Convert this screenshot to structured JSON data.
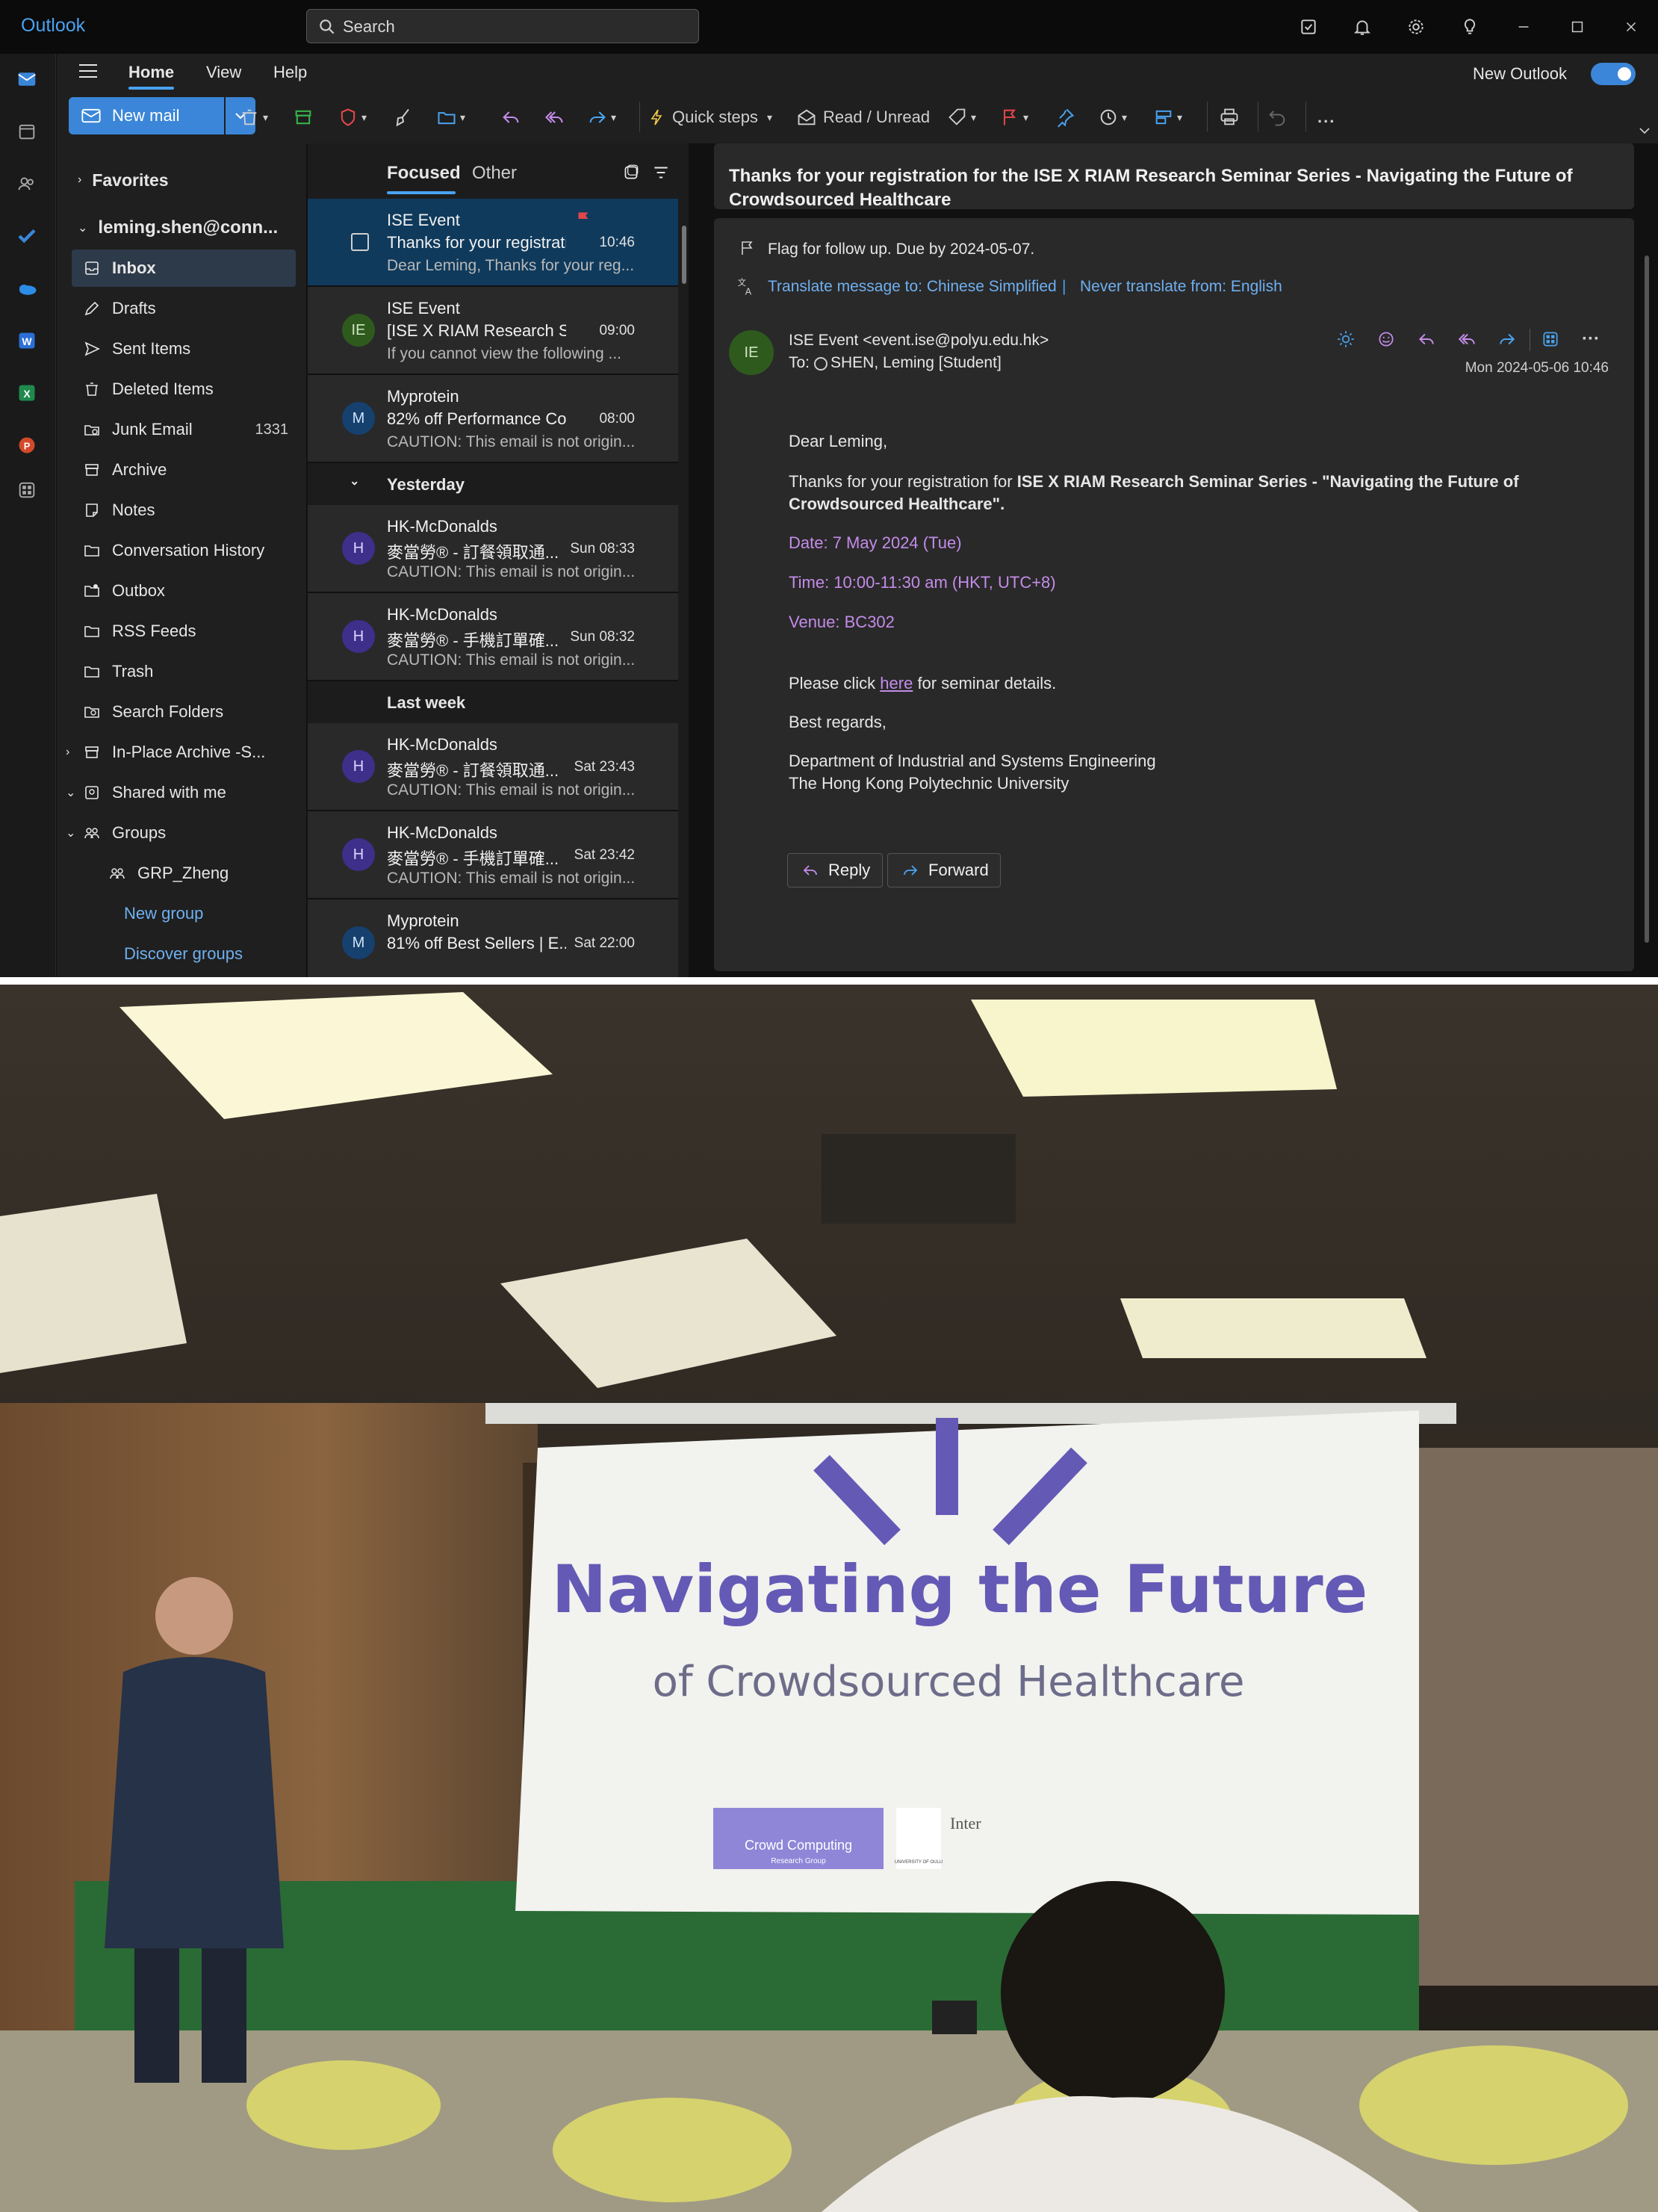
{
  "titlebar": {
    "app_name": "Outlook",
    "search_placeholder": "Search"
  },
  "ribbon": {
    "tabs": [
      "Home",
      "View",
      "Help"
    ],
    "new_outlook_label": "New Outlook",
    "new_mail_label": "New mail",
    "quick_steps_label": "Quick steps",
    "read_unread_label": "Read / Unread",
    "more_label": "..."
  },
  "folders": {
    "favorites_label": "Favorites",
    "account_label": "leming.shen@conn...",
    "items": [
      {
        "label": "Inbox",
        "count": ""
      },
      {
        "label": "Drafts",
        "count": ""
      },
      {
        "label": "Sent Items",
        "count": ""
      },
      {
        "label": "Deleted Items",
        "count": ""
      },
      {
        "label": "Junk Email",
        "count": "1331"
      },
      {
        "label": "Archive",
        "count": ""
      },
      {
        "label": "Notes",
        "count": ""
      },
      {
        "label": "Conversation History",
        "count": ""
      },
      {
        "label": "Outbox",
        "count": ""
      },
      {
        "label": "RSS Feeds",
        "count": ""
      },
      {
        "label": "Trash",
        "count": ""
      },
      {
        "label": "Search Folders",
        "count": ""
      },
      {
        "label": "In-Place Archive -S...",
        "count": ""
      },
      {
        "label": "Shared with me",
        "count": ""
      },
      {
        "label": "Groups",
        "count": ""
      },
      {
        "label": "GRP_Zheng",
        "count": ""
      }
    ],
    "new_group_label": "New group",
    "discover_groups_label": "Discover groups"
  },
  "maillist": {
    "tab_focused": "Focused",
    "tab_other": "Other",
    "group_yesterday": "Yesterday",
    "group_last_week": "Last week",
    "messages": [
      {
        "avatar": "",
        "from": "ISE Event",
        "subject": "Thanks for your registrati...",
        "time": "10:46",
        "preview": "Dear Leming, Thanks for your reg..."
      },
      {
        "avatar": "IE",
        "from": "ISE Event",
        "subject": "[ISE X RIAM Research Se...",
        "time": "09:00",
        "preview": "If you cannot view the following ..."
      },
      {
        "avatar": "M",
        "from": "Myprotein",
        "subject": "82% off Performance Coo...",
        "time": "08:00",
        "preview": "CAUTION: This email is not origin..."
      },
      {
        "avatar": "H",
        "from": "HK-McDonalds",
        "subject": "麥當勞® - 訂餐領取通...",
        "time": "Sun 08:33",
        "preview": "CAUTION: This email is not origin..."
      },
      {
        "avatar": "H",
        "from": "HK-McDonalds",
        "subject": "麥當勞® - 手機訂單確...",
        "time": "Sun 08:32",
        "preview": "CAUTION: This email is not origin..."
      },
      {
        "avatar": "H",
        "from": "HK-McDonalds",
        "subject": "麥當勞® - 訂餐領取通...",
        "time": "Sat 23:43",
        "preview": "CAUTION: This email is not origin..."
      },
      {
        "avatar": "H",
        "from": "HK-McDonalds",
        "subject": "麥當勞® - 手機訂單確...",
        "time": "Sat 23:42",
        "preview": "CAUTION: This email is not origin..."
      },
      {
        "avatar": "M",
        "from": "Myprotein",
        "subject": "81% off Best Sellers | E...",
        "time": "Sat 22:00",
        "preview": ""
      }
    ]
  },
  "reading": {
    "subject": "Thanks for your registration for the ISE X RIAM Research Seminar Series - Navigating the Future of Crowdsourced Healthcare",
    "flag_text": "Flag for follow up. Due by 2024-05-07.",
    "translate_text": "Translate message to: Chinese Simplified",
    "translate_sep": "|",
    "never_translate_text": "Never translate from: English",
    "sender_avatar": "IE",
    "sender": "ISE Event <event.ise@polyu.edu.hk>",
    "to_label": "To:",
    "to_value": "SHEN, Leming [Student]",
    "date": "Mon 2024-05-06 10:46",
    "greeting": "Dear Leming,",
    "thanks_prefix": "Thanks for your registration for ",
    "thanks_bold_1": "ISE X RIAM Research Seminar Series - \"Navigating the Future of",
    "thanks_bold_2": "Crowdsourced Healthcare\".",
    "date_line": "Date: 7 May 2024 (Tue)",
    "time_line": "Time: 10:00-11:30 am (HKT, UTC+8)",
    "venue_line": "Venue: BC302",
    "click_prefix": "Please click ",
    "click_link": "here",
    "click_suffix": " for seminar details.",
    "regards": "Best regards,",
    "dept": "Department of Industrial and Systems Engineering",
    "univ": "The Hong Kong Polytechnic University",
    "reply_label": "Reply",
    "forward_label": "Forward"
  },
  "photo": {
    "slide_title": "Navigating the Future",
    "slide_subtitle": "of Crowdsourced Healthcare",
    "logo_text_1": "Crowd Computing",
    "logo_text_2": "Research Group",
    "logo_text_3": "UNIVERSITY OF OULU",
    "logo_text_4": "Inter"
  },
  "colors": {
    "accent": "#3b86d8",
    "selected_row": "#0f3a5c",
    "highlight": "#c48ce9",
    "slide_purple": "#6459b5"
  }
}
